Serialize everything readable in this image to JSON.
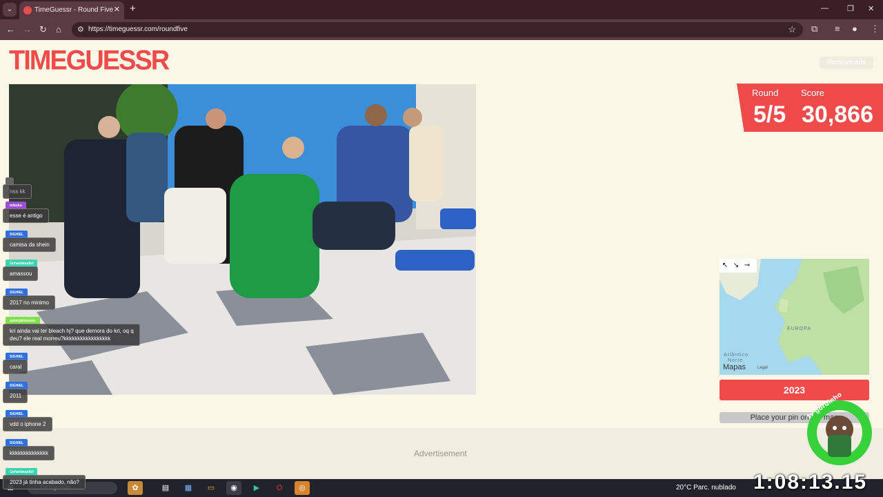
{
  "browser": {
    "tab_title": "TimeGuessr - Round Five",
    "tab_close": "✕",
    "new_tab": "+",
    "url": "https://timeguessr.com/roundfive",
    "controls": {
      "minimize": "—",
      "restore": "❐",
      "close": "✕"
    }
  },
  "page": {
    "logo": "TIMEGUESSR",
    "remove_ads": "Remove ads",
    "round_label": "Round",
    "round_value": "5/5",
    "score_label": "Score",
    "score_value": "30,866",
    "map": {
      "region_label": "EUROPA",
      "ocean_label_line1": "Atlântico",
      "ocean_label_line2": "Norte",
      "brand": "Mapas",
      "legal": "Legal"
    },
    "year": "2023",
    "place_pin": "Place your pin on the map",
    "advertisement": "Advertisement"
  },
  "chat": [
    {
      "name": "",
      "message": "nss kk",
      "color": "#666666"
    },
    {
      "name": "miboku",
      "message": "esse é antigo",
      "color": "#9b4fd6"
    },
    {
      "name": "SIGHIEL",
      "message": "camisa da shein",
      "color": "#2f6fe0"
    },
    {
      "name": "Gohanbeastlel",
      "message": "amassou",
      "color": "#3bd3b0"
    },
    {
      "name": "SIGHIEL",
      "message": "2017 no minimo",
      "color": "#2f6fe0"
    },
    {
      "name": "spinnyboisssss",
      "message": "kri ainda vai ter bleach hj? que demora do kri, oq q",
      "message2": "deu? ele real morreu?kkkkkkkkkkkkkkkkk",
      "color": "#7fe04a"
    },
    {
      "name": "SIGHIEL",
      "message": "caral",
      "color": "#2f6fe0"
    },
    {
      "name": "SIGHIEL",
      "message": "2011",
      "color": "#2f6fe0"
    },
    {
      "name": "SIGHIEL",
      "message": "vdd o iphone 2",
      "color": "#2f6fe0"
    },
    {
      "name": "SIGHIEL",
      "message": "kkkkkkkkkkkkkk",
      "color": "#2f6fe0"
    },
    {
      "name": "Gohanbeastlel",
      "message": "2023 já tinha acabado, não?",
      "color": "#3bd3b0"
    }
  ],
  "taskbar": {
    "search_placeholder": "Pesquisar",
    "weather": "20°C  Parc. nublado",
    "clock": "1:08:13.15"
  },
  "overlay_text": "tv gordinho"
}
